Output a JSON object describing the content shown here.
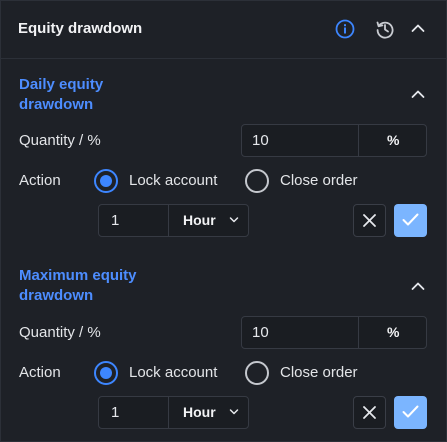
{
  "header": {
    "title": "Equity drawdown",
    "icons": [
      "info-icon",
      "history-icon",
      "chevron-up-icon"
    ]
  },
  "sections": [
    {
      "title_line1": "Daily equity",
      "title_line2": "drawdown",
      "quantity_label": "Quantity / %",
      "quantity_value": "10",
      "quantity_unit": "%",
      "action_label": "Action",
      "option_lock": "Lock account",
      "option_close": "Close order",
      "selected": "Lock account",
      "duration_value": "1",
      "duration_unit": "Hour"
    },
    {
      "title_line1": "Maximum equity",
      "title_line2": "drawdown",
      "quantity_label": "Quantity / %",
      "quantity_value": "10",
      "quantity_unit": "%",
      "action_label": "Action",
      "option_lock": "Lock account",
      "option_close": "Close order",
      "selected": "Lock account",
      "duration_value": "1",
      "duration_unit": "Hour"
    }
  ],
  "colors": {
    "accent": "#3d86ff",
    "section_title": "#4d8dff",
    "confirm_button": "#7bb5ff",
    "background": "#1e2127"
  }
}
